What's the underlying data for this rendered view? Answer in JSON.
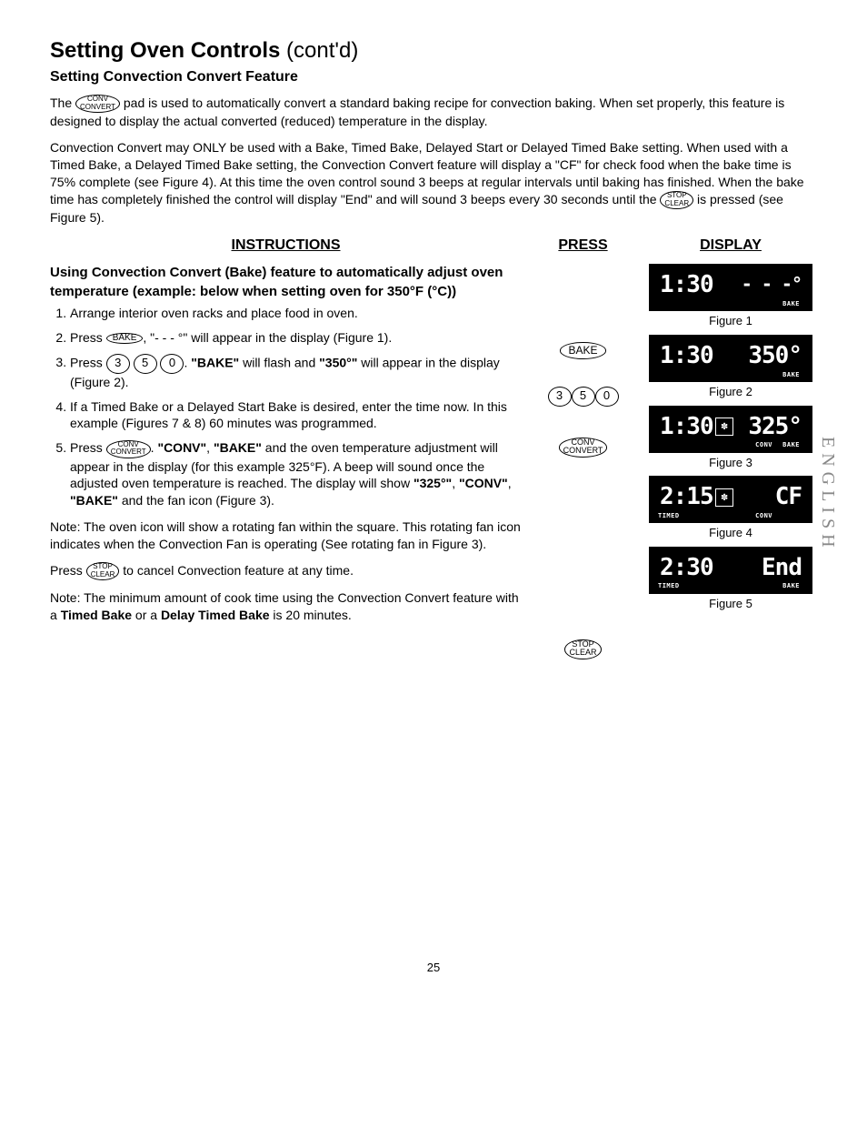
{
  "title_main": "Setting Oven Controls",
  "title_suffix": "(cont'd)",
  "subtitle": "Setting Convection Convert Feature",
  "intro_pre": "The ",
  "pad_conv_top": "CONV",
  "pad_conv_bot": "CONVERT",
  "intro_post": " pad is used to automatically convert a standard baking recipe for convection baking. When set properly, this feature is designed to display the actual converted (reduced) temperature in the display.",
  "para2_pre": "Convection Convert may ONLY be used with a Bake, Timed Bake, Delayed Start or Delayed Timed Bake setting. When used with a Timed Bake, a Delayed Timed Bake setting, the Convection Convert feature will display a \"CF\" for check food when the bake time is 75% complete (see Figure 4). At this time the oven control sound 3 beeps at regular intervals until baking has finished. When the bake time has completely finished the control will display \"End\" and will sound 3 beeps every 30 seconds until the ",
  "pad_stop_top": "STOP",
  "pad_stop_bot": "CLEAR",
  "para2_post": " is pressed (see Figure 5).",
  "head_instructions": "INSTRUCTIONS",
  "head_press": "PRESS",
  "head_display": "DISPLAY",
  "example_heading": "Using Convection Convert (Bake) feature to automatically adjust oven temperature (example: below when setting oven for 350°F (°C))",
  "step1": "Arrange interior oven racks and place food in oven.",
  "step2_pre": "Press ",
  "pad_bake": "BAKE",
  "step2_post": ", \"- - - °\" will appear in the display (Figure 1).",
  "step3_pre": "Press ",
  "num3": "3",
  "num5": "5",
  "num0": "0",
  "step3_mid": ". ",
  "step3_bake": "\"BAKE\"",
  "step3_mid2": " will flash and ",
  "step3_350": "\"350°\"",
  "step3_post": " will appear in the display (Figure 2).",
  "step4": "If a Timed Bake or a Delayed Start Bake is desired, enter the time now. In this example (Figures 7 & 8) 60 minutes was programmed.",
  "step5_pre": "Press ",
  "step5_mid1": ". ",
  "step5_conv": "\"CONV\"",
  "step5_comma": ", ",
  "step5_bake": "\"BAKE\"",
  "step5_post1": " and the oven temperature adjustment will appear in the display (for this example 325°F). A beep will sound once the adjusted oven temperature is reached. The display will show ",
  "step5_325": "\"325°\"",
  "step5_post2": " and the fan icon (Figure 3).",
  "note1": "Note: The oven icon will show a rotating fan within the square. This rotating fan icon indicates when the Convection Fan is operating (See rotating fan in Figure 3).",
  "cancel_pre": "Press ",
  "cancel_post": " to cancel Convection feature at any time.",
  "note2_pre": "Note: The minimum amount of cook time using the Convection Convert feature with a ",
  "note2_tb": "Timed Bake",
  "note2_mid": " or a ",
  "note2_dtb": "Delay Timed Bake",
  "note2_post": " is 20 minutes.",
  "fig1_time": "1:30",
  "fig1_right": "- - -°",
  "fig1_caption": "Figure 1",
  "fig2_time": "1:30",
  "fig2_right": "350°",
  "fig2_caption": "Figure 2",
  "fig3_time": "1:30",
  "fig3_right": "325°",
  "fig3_caption": "Figure 3",
  "fig4_time": "2:15",
  "fig4_right": "CF",
  "fig4_caption": "Figure 4",
  "fig5_time": "2:30",
  "fig5_right": "End",
  "fig5_caption": "Figure 5",
  "label_bake": "BAKE",
  "label_conv": "CONV",
  "label_timed": "TIMED",
  "fan_symbol": "✽",
  "side_english": "ENGLISH",
  "page_number": "25"
}
